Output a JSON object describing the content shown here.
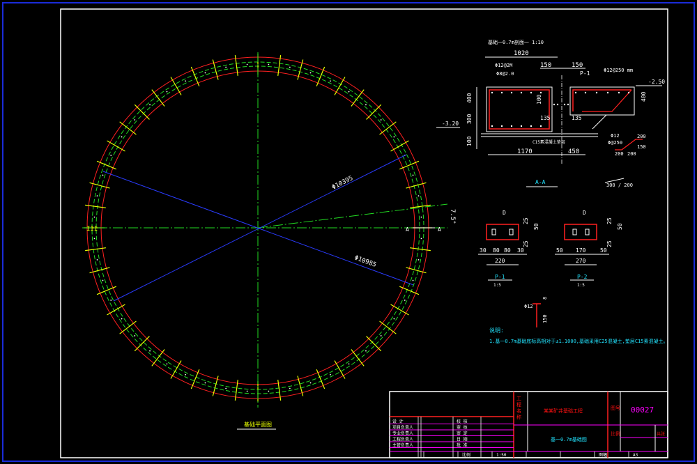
{
  "colors": {
    "background": "#000000",
    "frame_outer": "#1a2bd9",
    "frame_inner": "#ffffff",
    "ring_red": "#ff2020",
    "ring_green": "#22dd22",
    "tick_yellow": "#e8ff00",
    "radial_blue": "#2a3cff",
    "axis_green": "#22dd22",
    "dim_white": "#ffffff",
    "cyan_text": "#22e4ff",
    "magenta_line": "#ff00ff",
    "title_red": "#ff1010"
  },
  "plan": {
    "dia_label_1": "Φ10395",
    "dia_label_2": "Φ10985",
    "angle_label": "7.5°",
    "left_marker": "III",
    "section_mark_left": "A",
    "section_mark_right": "A",
    "caption": "基础平面图"
  },
  "section": {
    "title": "基础一0.7m剖面一 1:10",
    "dim_1020": "1020",
    "dim_150a": "150",
    "dim_150b": "150",
    "label_phi12a": "Φ12@2M",
    "label_phi8": "Φ8@2.0",
    "label_p1": "P-1",
    "label_phi12b": "Φ12@250 mm",
    "label_level_top": "-2.50",
    "dim_400l": "400",
    "dim_300": "300",
    "dim_100l": "100",
    "dim_100c": "100",
    "dim_135a": "135",
    "dim_135b": "135",
    "dim_400r": "400",
    "label_level_left": "-3.20",
    "label_concrete": "C15素混凝土垫层",
    "label_phi12c": "Φ12",
    "label_phi12d": "Φ@250",
    "dim_200a": "200",
    "dim_150c": "150",
    "dim_200b": "200",
    "dim_200c": "200",
    "dim_1170": "1170",
    "dim_450": "450",
    "caption": "A-A",
    "slope": "300 / 200"
  },
  "details": {
    "p1": {
      "d_top": "D",
      "d25a": "25",
      "d50": "50",
      "d25b": "25",
      "b1": "30",
      "b2": "80",
      "b3": "80",
      "b4": "30",
      "total": "220",
      "label": "P-1",
      "sub": "1:5"
    },
    "p2": {
      "d_top": "D",
      "d25a": "25",
      "d50": "50",
      "d25b": "25",
      "b1": "50",
      "b2": "170",
      "b3": "50",
      "total": "270",
      "label": "P-2",
      "sub": "1:5"
    },
    "hook": {
      "phi": "Φ12",
      "d8": "8",
      "d150": "150"
    }
  },
  "notes": {
    "heading": "说明:",
    "line1": "1.基一0.7m基础底标高相对于±1.1000,基础采用C25混凝土,垫层C15素混凝土。"
  },
  "title_block": {
    "col_a": [
      "工",
      "程",
      "名",
      "称"
    ],
    "project": "某某矿井基础工程",
    "drawing_name": "基一0.7m基础图",
    "field_no": "图号",
    "drawing_no": "00027",
    "scale_label": "比例",
    "sheet_label": "共张",
    "rows": [
      {
        "role": "设 计",
        "sign": "校 核"
      },
      {
        "role": "项目负责人",
        "sign": "审 核"
      },
      {
        "role": "专业负责人",
        "sign": "审 定"
      },
      {
        "role": "工程负责人",
        "sign": "日 期"
      },
      {
        "role": "主管负责人",
        "sign": "批 准"
      }
    ],
    "bottom": [
      "",
      "",
      "比例",
      "1:50",
      "",
      "",
      "图幅",
      "A3"
    ]
  }
}
